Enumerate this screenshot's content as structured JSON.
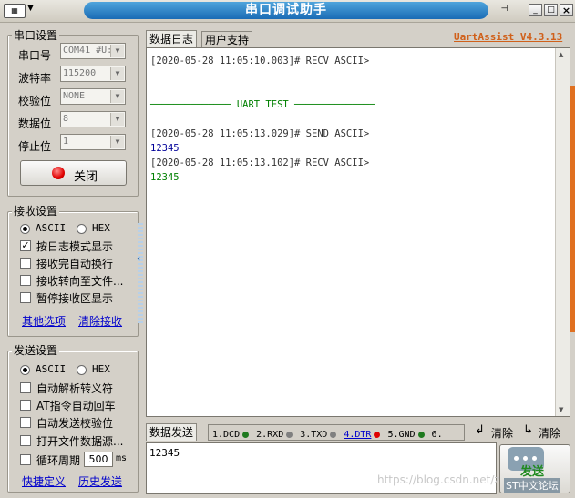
{
  "window": {
    "title": "串口调试助手",
    "menu_glyph": "▼",
    "pin_glyph": "⊣",
    "min_glyph": "_",
    "max_glyph": "□",
    "close_glyph": "×"
  },
  "serial": {
    "group_title": "串口设置",
    "port_label": "串口号",
    "port_value": "COM41 #U:",
    "baud_label": "波特率",
    "baud_value": "115200",
    "parity_label": "校验位",
    "parity_value": "NONE",
    "data_label": "数据位",
    "data_value": "8",
    "stop_label": "停止位",
    "stop_value": "1",
    "close_button": "关闭"
  },
  "receive": {
    "group_title": "接收设置",
    "ascii_label": "ASCII",
    "hex_label": "HEX",
    "options": [
      {
        "label": "按日志模式显示",
        "checked": true
      },
      {
        "label": "接收完自动换行",
        "checked": false
      },
      {
        "label": "接收转向至文件...",
        "checked": false
      },
      {
        "label": "暂停接收区显示",
        "checked": false
      }
    ],
    "more_link": "其他选项",
    "clear_link": "清除接收"
  },
  "send": {
    "group_title": "发送设置",
    "ascii_label": "ASCII",
    "hex_label": "HEX",
    "options": [
      {
        "label": "自动解析转义符",
        "checked": false
      },
      {
        "label": "AT指令自动回车",
        "checked": false
      },
      {
        "label": "自动发送校验位",
        "checked": false
      },
      {
        "label": "打开文件数据源...",
        "checked": false
      }
    ],
    "loop_label": "循环周期",
    "loop_value": "500",
    "loop_unit": "ms",
    "shortcut_link": "快捷定义",
    "history_link": "历史发送"
  },
  "tabs": {
    "log": "数据日志",
    "support": "用户支持",
    "brand": "UartAssist V4.3.13"
  },
  "log_lines": [
    {
      "text": "[2020-05-28 11:05:10.003]# RECV ASCII>",
      "color": "#333333"
    },
    {
      "text": "",
      "color": "#333333"
    },
    {
      "text": "",
      "color": "#333333"
    },
    {
      "text": "────────────── UART TEST ──────────────",
      "color": "#008000"
    },
    {
      "text": "",
      "color": "#333333"
    },
    {
      "text": "[2020-05-28 11:05:13.029]# SEND ASCII>",
      "color": "#333333"
    },
    {
      "text": "12345",
      "color": "#000099"
    },
    {
      "text": "[2020-05-28 11:05:13.102]# RECV ASCII>",
      "color": "#333333"
    },
    {
      "text": "12345",
      "color": "#008000"
    }
  ],
  "bottom": {
    "send_tab": "数据发送",
    "signals": [
      {
        "label": "1.DCD",
        "color": "#1f7a1f"
      },
      {
        "label": "2.RXD",
        "color": "#808080"
      },
      {
        "label": "3.TXD",
        "color": "#808080"
      },
      {
        "label": "4.DTR",
        "color": "#e00000"
      },
      {
        "label": "5.GND",
        "color": "#1f7a1f"
      },
      {
        "label": "6.",
        "color": "#808080"
      }
    ],
    "clear1": "清除",
    "clear2": "清除",
    "send_text": "12345",
    "send_button": "发送",
    "watermark": "https://blog.csdn.net/zhang",
    "badge": "ST中文论坛"
  }
}
